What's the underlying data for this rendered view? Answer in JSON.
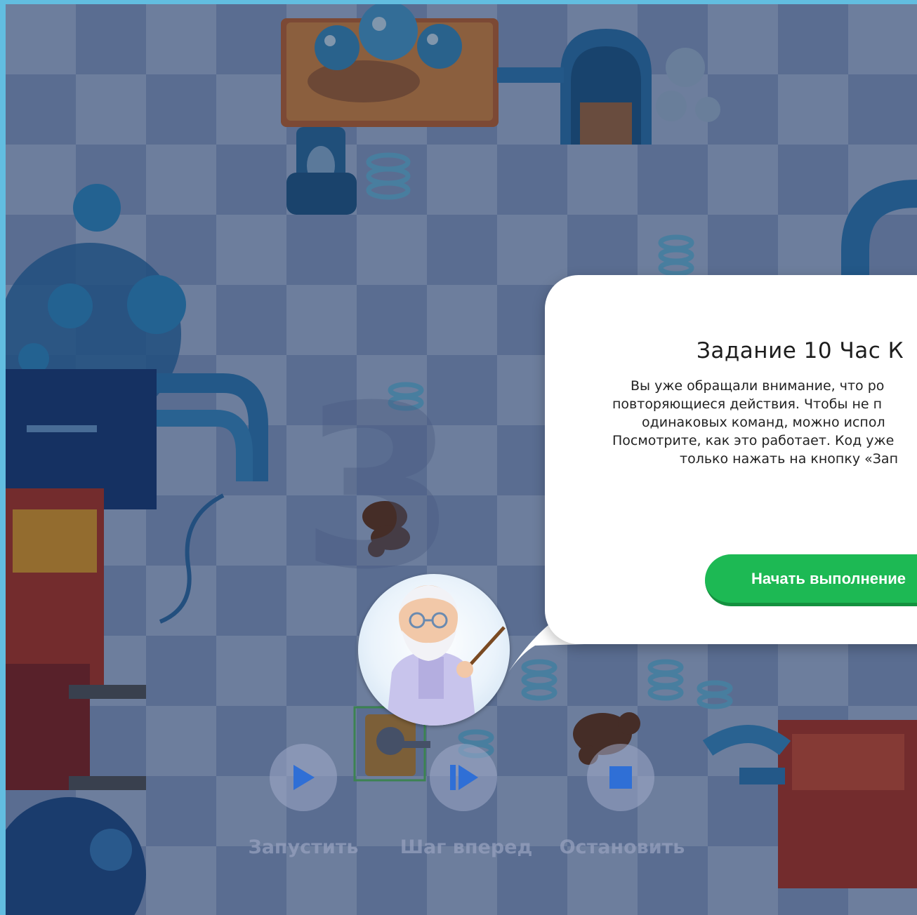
{
  "dialog": {
    "title": "Задание 10 Час К",
    "body_lines": [
      "Вы уже обращали внимание, что ро",
      "повторяющиеся действия. Чтобы не п",
      "одинаковых команд, можно испол",
      "Посмотрите, как это работает. Код уже",
      "только нажать на кнопку «Зап"
    ],
    "start_button_label": "Начать выполнение"
  },
  "controls": {
    "run_label": "Запустить",
    "step_label": "Шаг вперед",
    "stop_label": "Остановить"
  },
  "colors": {
    "accent_green": "#1db954",
    "frame_blue": "#62bde0",
    "control_blue": "#2f6fd6"
  },
  "icons": [
    "play-icon",
    "step-forward-icon",
    "stop-icon"
  ]
}
